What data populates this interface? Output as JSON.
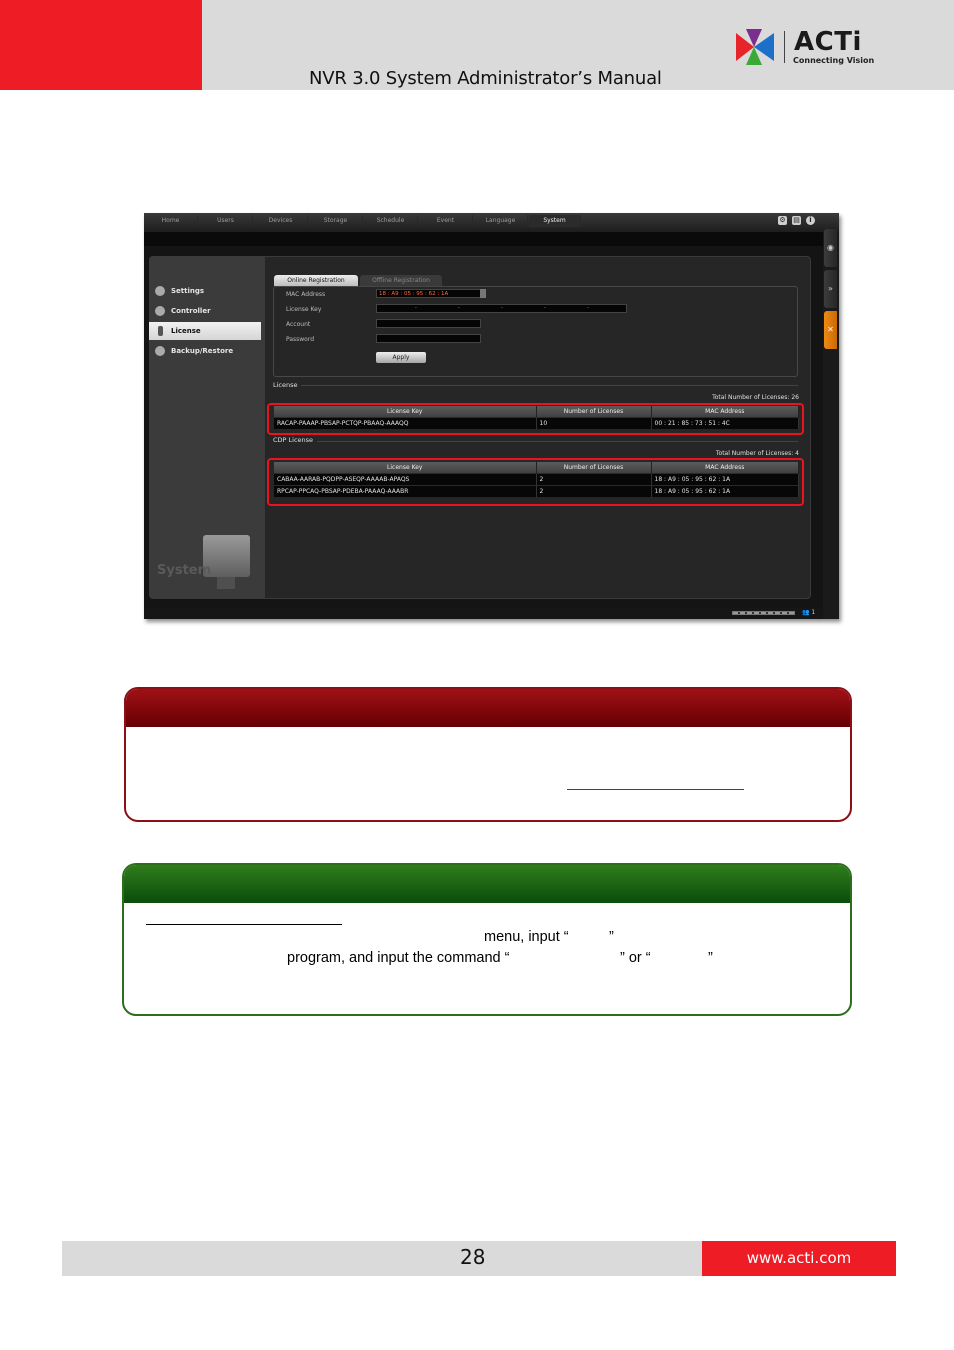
{
  "header": {
    "title": "NVR 3.0 System Administrator’s Manual",
    "logo_word": "ACTi",
    "logo_tagline": "Connecting Vision"
  },
  "nvr": {
    "top_icons": [
      "gear-icon",
      "document-icon",
      "info-icon"
    ],
    "nav_tabs": [
      "Home",
      "Users",
      "Devices",
      "Storage",
      "Schedule",
      "Event",
      "Language",
      "System"
    ],
    "active_nav": "System",
    "sidebar": {
      "items": [
        "Settings",
        "Controller",
        "License",
        "Backup/Restore"
      ],
      "active": "License",
      "watermark": "System"
    },
    "sub_tabs": [
      "Online Registration",
      "Offline Registration"
    ],
    "form": {
      "mac_label": "MAC Address",
      "mac_value": "18 : A9 : 05 : 95 : 62 : 1A",
      "license_key_label": "License Key",
      "license_key_separators": [
        "-",
        "-",
        "-",
        "-",
        "-"
      ],
      "account_label": "Account",
      "password_label": "Password",
      "apply_label": "Apply"
    },
    "license": {
      "section_label": "License",
      "total": "Total Number of Licenses: 26",
      "headers": [
        "License Key",
        "Number of Licenses",
        "MAC Address"
      ],
      "rows": [
        [
          "RACAP-PAAAP-PBSAP-PCTQP-PBAAQ-AAAQQ",
          "10",
          "00 : 21 : 85 : 73 : 51 : 4C"
        ]
      ]
    },
    "cdp_license": {
      "section_label": "CDP License",
      "total": "Total Number of Licenses: 4",
      "headers": [
        "License Key",
        "Number of Licenses",
        "MAC Address"
      ],
      "rows": [
        [
          "CABAA-AARAB-PQDPP-ASEQP-AAAAB-APAQS",
          "2",
          "18 : A9 : 05 : 95 : 62 : 1A"
        ],
        [
          "RPCAP-PPCAQ-PBSAP-PDEBA-PAAAQ-AAABR",
          "2",
          "18 : A9 : 05 : 95 : 62 : 1A"
        ]
      ]
    },
    "status": {
      "user_count": "1"
    }
  },
  "note_two": {
    "line1_a": "menu, input “",
    "line1_b": "”",
    "line2_a": "program, and input the command “",
    "line2_b": "” or “",
    "line2_c": "”"
  },
  "footer": {
    "page_number": "28",
    "url": "www.acti.com"
  },
  "colors": {
    "brand_red": "#ee1c25",
    "header_gray": "#dadada",
    "highlight_red": "#e8151e",
    "note_dark_red": "#8b0f14",
    "note_green": "#2c6e1c"
  }
}
